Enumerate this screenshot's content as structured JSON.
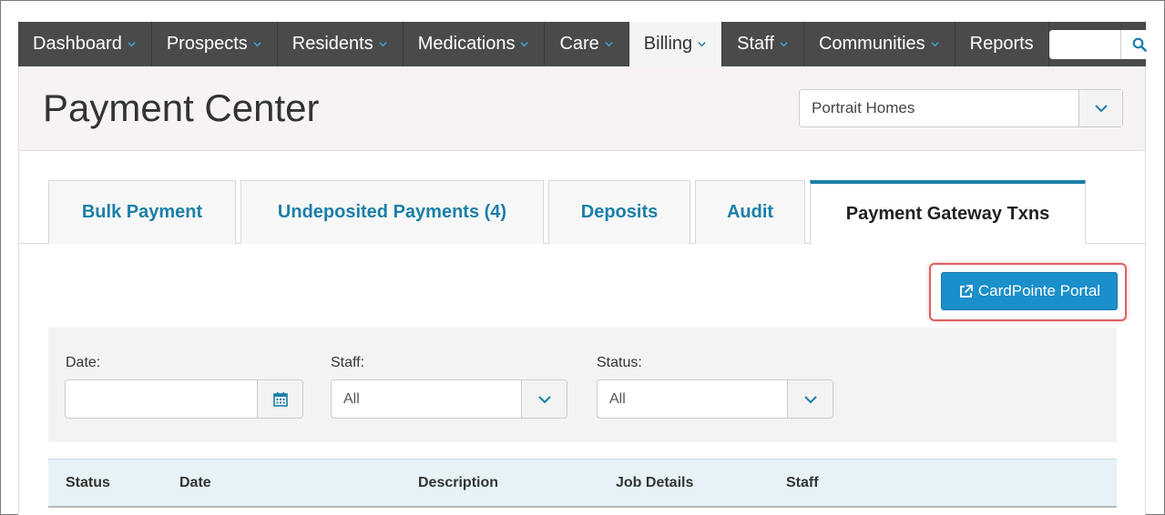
{
  "nav": {
    "items": [
      {
        "label": "Dashboard",
        "dropdown": true
      },
      {
        "label": "Prospects",
        "dropdown": true
      },
      {
        "label": "Residents",
        "dropdown": true
      },
      {
        "label": "Medications",
        "dropdown": true
      },
      {
        "label": "Care",
        "dropdown": true
      },
      {
        "label": "Billing",
        "dropdown": true,
        "active": true
      },
      {
        "label": "Staff",
        "dropdown": true
      },
      {
        "label": "Communities",
        "dropdown": true
      },
      {
        "label": "Reports",
        "dropdown": false
      }
    ],
    "search": {
      "value": "",
      "icon": "search-icon"
    }
  },
  "header": {
    "title": "Payment Center",
    "community_select": {
      "value": "Portrait Homes",
      "icon": "chevron-down-icon"
    }
  },
  "tabs": [
    {
      "label": "Bulk Payment"
    },
    {
      "label": "Undeposited Payments (4)"
    },
    {
      "label": "Deposits"
    },
    {
      "label": "Audit"
    },
    {
      "label": "Payment Gateway Txns",
      "active": true
    }
  ],
  "actions": {
    "cardpointe_label": "CardPointe Portal",
    "cardpointe_icon": "external-link-icon",
    "highlight_color": "#e06060"
  },
  "filters": {
    "date": {
      "label": "Date:",
      "value": "",
      "icon": "calendar-icon"
    },
    "staff": {
      "label": "Staff:",
      "value": "All"
    },
    "status": {
      "label": "Status:",
      "value": "All"
    }
  },
  "table": {
    "columns": [
      "Status",
      "Date",
      "Description",
      "Job Details",
      "Staff"
    ]
  },
  "colors": {
    "nav_bg": "#4a4a4a",
    "accent": "#1a7fa8",
    "button": "#1a8fc9"
  }
}
